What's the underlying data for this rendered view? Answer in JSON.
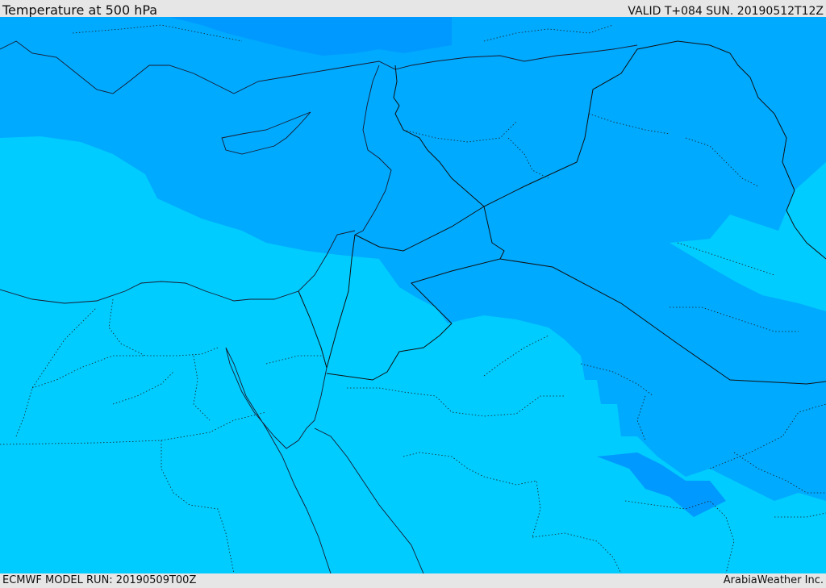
{
  "header": {
    "title": "Temperature at 500 hPa",
    "valid": "VALID T+084 SUN. 20190512T12Z"
  },
  "footer": {
    "model_run": "ECMWF MODEL RUN: 20190509T00Z",
    "credit": "ArabiaWeather Inc."
  },
  "colors": {
    "band_cold": "#0099ff",
    "band_mid": "#00aaff",
    "band_warm": "#00ccff",
    "line": "#1a1a2e",
    "bar": "#e6e6e6"
  }
}
